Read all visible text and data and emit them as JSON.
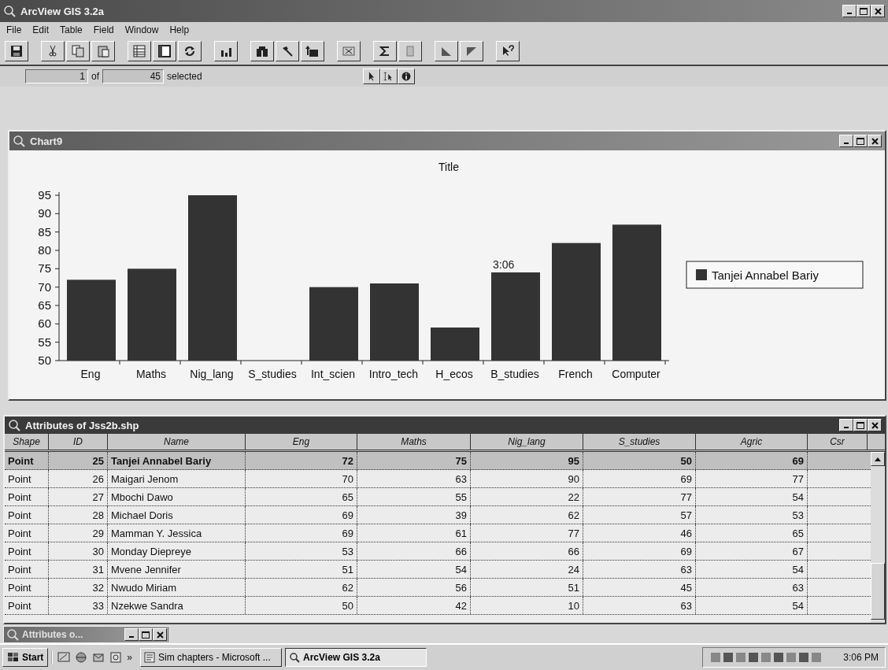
{
  "window": {
    "title": "ArcView GIS 3.2a"
  },
  "menu": [
    "File",
    "Edit",
    "Table",
    "Field",
    "Window",
    "Help"
  ],
  "status": {
    "current": "1",
    "of_label": "of",
    "count": "45",
    "selected_label": "selected"
  },
  "chart_window": {
    "title": "Chart9",
    "chart_data": {
      "type": "bar",
      "title": "Title",
      "categories": [
        "Eng",
        "Maths",
        "Nig_lang",
        "S_studies",
        "Int_scien",
        "Intro_tech",
        "H_ecos",
        "B_studies",
        "French",
        "Computer"
      ],
      "series": [
        {
          "name": "Tanjei Annabel Bariy",
          "color": "#333333",
          "values": [
            72,
            75,
            95,
            50,
            70,
            71,
            59,
            74,
            82,
            87
          ]
        }
      ],
      "ylim": [
        50,
        95
      ],
      "yticks": [
        50,
        55,
        60,
        65,
        70,
        75,
        80,
        85,
        90,
        95
      ],
      "annotations": [
        "3:06"
      ]
    }
  },
  "table_window": {
    "title": "Attributes of Jss2b.shp",
    "columns": [
      "Shape",
      "ID",
      "Name",
      "Eng",
      "Maths",
      "Nig_lang",
      "S_studies",
      "Agric",
      "Csr"
    ],
    "rows": [
      {
        "selected": true,
        "cells": [
          "Point",
          "25",
          "Tanjei Annabel Bariy",
          "72",
          "75",
          "95",
          "50",
          "69"
        ]
      },
      {
        "selected": false,
        "cells": [
          "Point",
          "26",
          "Maigari Jenom",
          "70",
          "63",
          "90",
          "69",
          "77"
        ]
      },
      {
        "selected": false,
        "cells": [
          "Point",
          "27",
          "Mbochi Dawo",
          "65",
          "55",
          "22",
          "77",
          "54"
        ]
      },
      {
        "selected": false,
        "cells": [
          "Point",
          "28",
          "Michael Doris",
          "69",
          "39",
          "62",
          "57",
          "53"
        ]
      },
      {
        "selected": false,
        "cells": [
          "Point",
          "29",
          "Mamman Y. Jessica",
          "69",
          "61",
          "77",
          "46",
          "65"
        ]
      },
      {
        "selected": false,
        "cells": [
          "Point",
          "30",
          "Monday Diepreye",
          "53",
          "66",
          "66",
          "69",
          "67"
        ]
      },
      {
        "selected": false,
        "cells": [
          "Point",
          "31",
          "Mvene Jennifer",
          "51",
          "54",
          "24",
          "63",
          "54"
        ]
      },
      {
        "selected": false,
        "cells": [
          "Point",
          "32",
          "Nwudo Miriam",
          "62",
          "56",
          "51",
          "45",
          "63"
        ]
      },
      {
        "selected": false,
        "cells": [
          "Point",
          "33",
          "Nzekwe Sandra",
          "50",
          "42",
          "10",
          "63",
          "54"
        ]
      }
    ]
  },
  "minimized_window": {
    "title": "Attributes o..."
  },
  "taskbar": {
    "start": "Start",
    "more": "»",
    "tasks": [
      {
        "label": "Sim chapters - Microsoft ...",
        "selected": false
      },
      {
        "label": "ArcView GIS 3.2a",
        "selected": true
      }
    ],
    "clock": "3:06 PM"
  }
}
